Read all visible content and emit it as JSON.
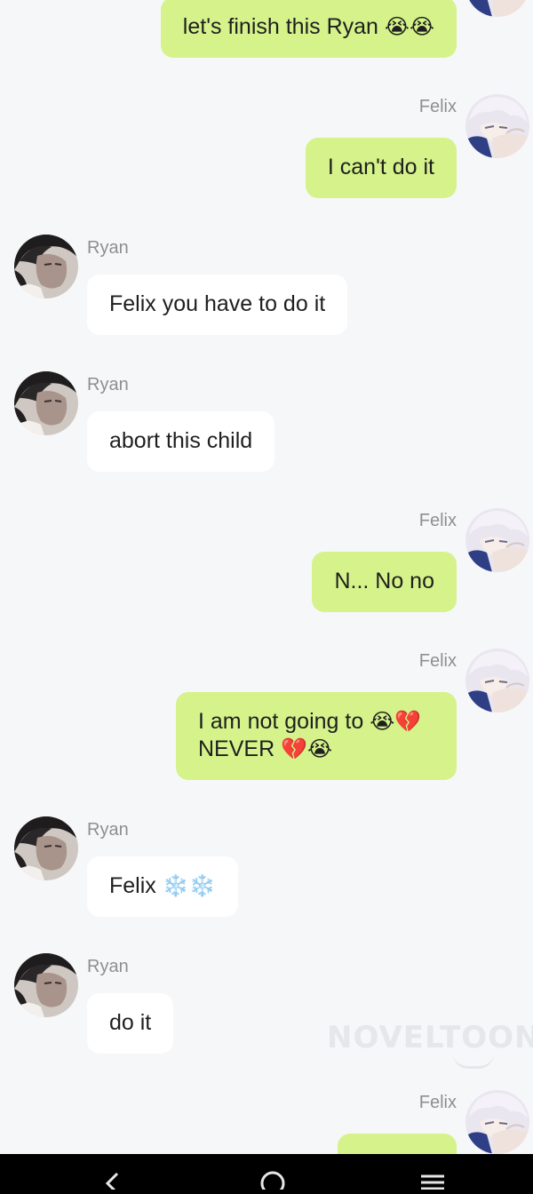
{
  "messages": [
    {
      "sender": "Felix",
      "text": "let's finish this  Ryan",
      "emoji": "😭😭",
      "show_name": false
    },
    {
      "sender": "Felix",
      "text": "I can't do it",
      "emoji": "",
      "show_name": true
    },
    {
      "sender": "Ryan",
      "text": "Felix you have to do it",
      "emoji": "",
      "show_name": true
    },
    {
      "sender": "Ryan",
      "text": "abort this child",
      "emoji": "",
      "show_name": true
    },
    {
      "sender": "Felix",
      "text": "N... No no",
      "emoji": "",
      "show_name": true
    },
    {
      "sender": "Felix",
      "text": "I am not going to",
      "emoji": "😭💔",
      "text2": "NEVER",
      "emoji2": "💔😭",
      "show_name": true
    },
    {
      "sender": "Ryan",
      "text": "Felix",
      "emoji": "❄️❄️",
      "show_name": true
    },
    {
      "sender": "Ryan",
      "text": "do it",
      "emoji": "",
      "show_name": true
    },
    {
      "sender": "Felix",
      "text": "",
      "emoji": "",
      "show_name": true
    }
  ],
  "watermark": "NOVELTOON",
  "nav": {
    "back_icon": "chevron-left-icon",
    "home_icon": "circle-home-icon",
    "menu_icon": "menu-lines-icon"
  },
  "colors": {
    "felix_bubble": "#d5f38a",
    "ryan_bubble": "#ffffff",
    "background": "#f6f7f9",
    "name_text": "#8f8f8f"
  }
}
